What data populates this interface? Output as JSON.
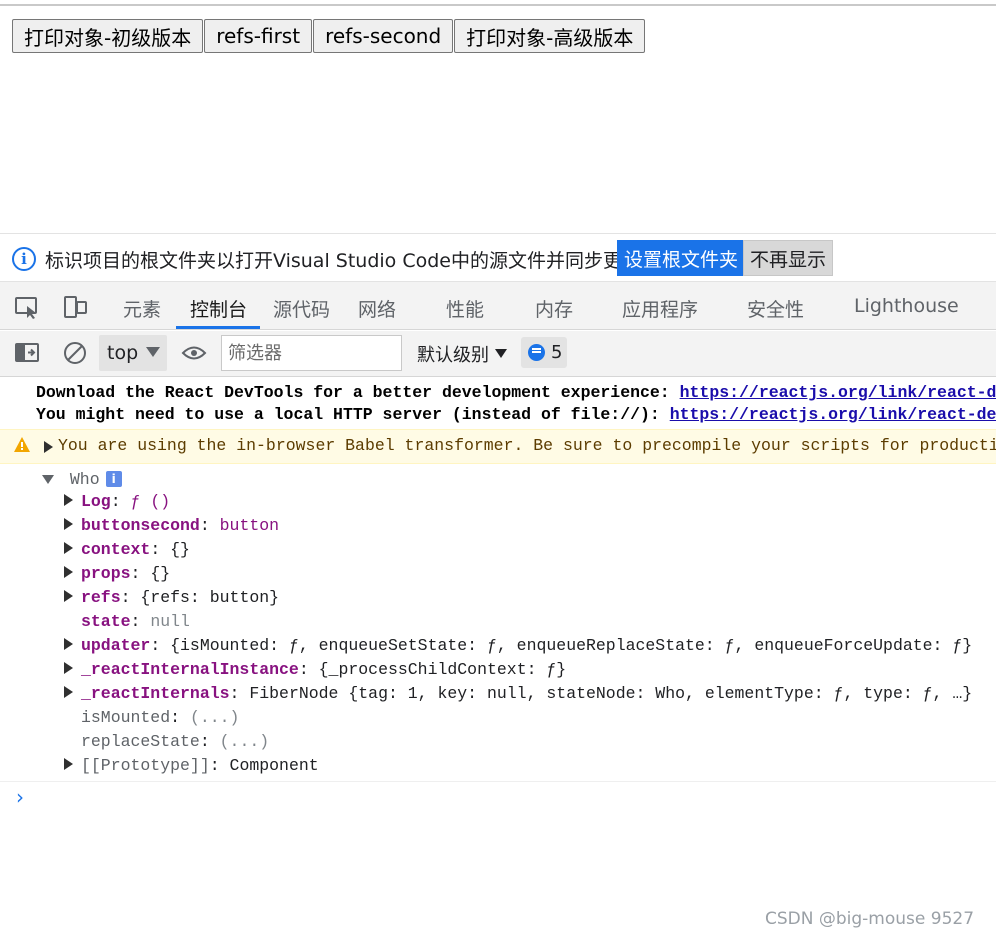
{
  "page_buttons": [
    "打印对象-初级版本",
    "refs-first",
    "refs-second",
    "打印对象-高级版本"
  ],
  "infobar": {
    "message": "标识项目的根文件夹以打开Visual Studio Code中的源文件并同步更改。",
    "primary_action": "设置根文件夹",
    "secondary_action": "不再显示"
  },
  "devtools": {
    "tabs": [
      "元素",
      "控制台",
      "源代码",
      "网络",
      "性能",
      "内存",
      "应用程序",
      "安全性",
      "Lighthouse"
    ],
    "active_tab": "控制台"
  },
  "console_toolbar": {
    "context": "top",
    "filter_placeholder": "筛选器",
    "level": "默认级别",
    "issues_count": "5"
  },
  "console": {
    "line1_text": "Download the React DevTools for a better development experience: ",
    "line1_link": "https://reactjs.org/link/react-devtools",
    "line2_text": "You might need to use a local HTTP server (instead of file://): ",
    "line2_link": "https://reactjs.org/link/react-devtools-faq",
    "warning": "You are using the in-browser Babel transformer. Be sure to precompile your scripts for production",
    "object_name": "Who",
    "props": [
      {
        "key": "Log",
        "sep": ": ",
        "value": "ƒ ()",
        "expandable": true
      },
      {
        "key": "buttonsecond",
        "sep": ": ",
        "value": "button",
        "expandable": true
      },
      {
        "key": "context",
        "sep": ": ",
        "value": "{}",
        "expandable": true
      },
      {
        "key": "props",
        "sep": ": ",
        "value": "{}",
        "expandable": true
      },
      {
        "key": "refs",
        "sep": ": ",
        "value": "{refs: button}",
        "expandable": true
      },
      {
        "key": "state",
        "sep": ": ",
        "value": "null",
        "expandable": false
      },
      {
        "key": "updater",
        "sep": ": ",
        "value": "{isMounted: ƒ, enqueueSetState: ƒ, enqueueReplaceState: ƒ, enqueueForceUpdate: ƒ}",
        "expandable": true
      },
      {
        "key": "_reactInternalInstance",
        "sep": ": ",
        "value": "{_processChildContext: ƒ}",
        "expandable": true
      },
      {
        "key": "_reactInternals",
        "sep": ": ",
        "value": "FiberNode {tag: 1, key: null, stateNode: Who, elementType: ƒ, type: ƒ, …}",
        "expandable": true
      },
      {
        "key": "isMounted",
        "sep": ": ",
        "value": "(...)",
        "expandable": false,
        "plain": true
      },
      {
        "key": "replaceState",
        "sep": ": ",
        "value": "(...)",
        "expandable": false,
        "plain": true
      },
      {
        "key": "[[Prototype]]",
        "sep": ": ",
        "value": "Component",
        "expandable": true,
        "plain": true
      }
    ],
    "prompt": "›"
  },
  "watermark": "CSDN @big-mouse 9527"
}
